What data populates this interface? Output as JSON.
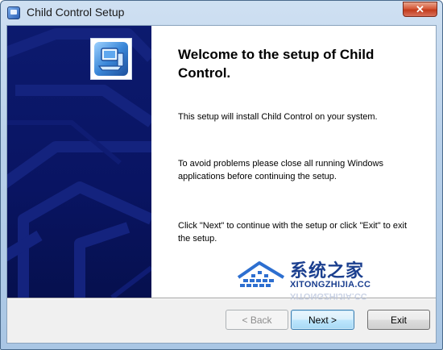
{
  "window": {
    "title": "Child Control Setup",
    "close_glyph": "✕"
  },
  "content": {
    "heading": "Welcome to the setup of Child Control.",
    "paragraph1": "This setup will install Child Control on your system.",
    "paragraph2": "To avoid problems please close all running Windows applications before continuing the setup.",
    "paragraph3": "Click \"Next\" to continue with the setup or click \"Exit\" to exit the setup."
  },
  "buttons": {
    "back": "< Back",
    "next": "Next >",
    "exit": "Exit"
  },
  "watermark": {
    "brand": "系统之家",
    "domain": "XITONGZHIJIA.CC"
  },
  "colors": {
    "banner": "#091462",
    "accent": "#1b3f8f"
  },
  "icons": {
    "app": "app-icon",
    "logo": "computer-logo-icon",
    "close": "close-icon"
  }
}
